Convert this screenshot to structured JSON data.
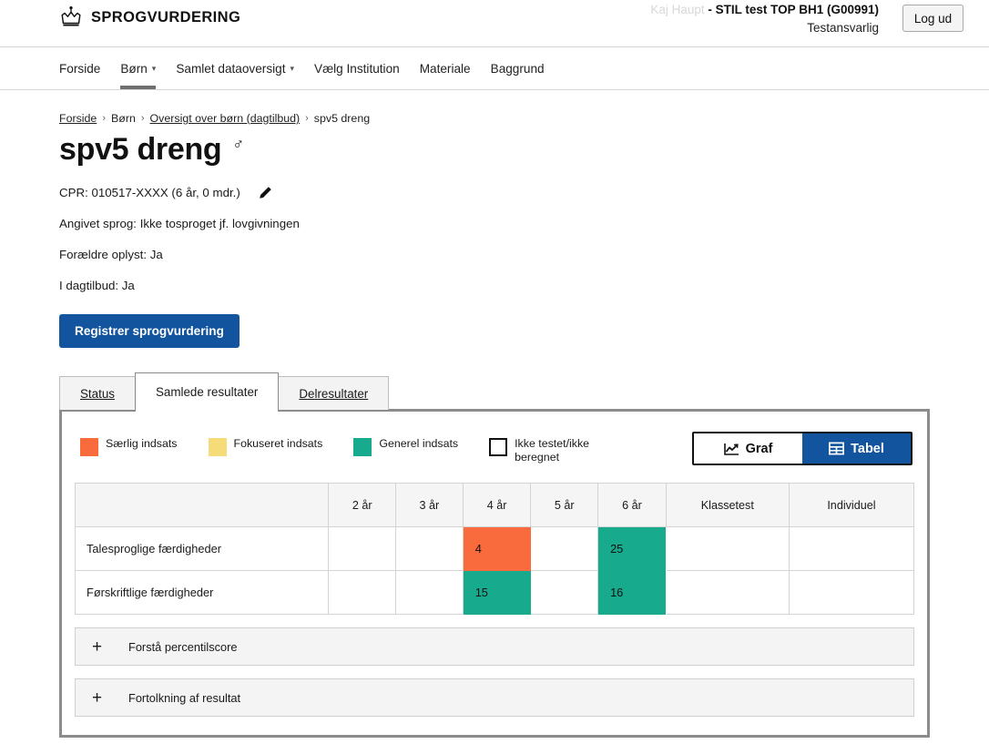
{
  "header": {
    "brand": "SPROGVURDERING",
    "brand_icon": "crown-icon",
    "user_name": "Kaj Haupt",
    "user_org": " - STIL test TOP BH1 (G00991)",
    "user_role": "Testansvarlig",
    "logout_label": "Log ud"
  },
  "nav": {
    "items": [
      {
        "label": "Forside",
        "caret": "",
        "active": false
      },
      {
        "label": "Børn",
        "caret": "⌄",
        "active": true
      },
      {
        "label": "Samlet dataoversigt",
        "caret": "⌄",
        "active": false
      },
      {
        "label": "Vælg Institution",
        "caret": "",
        "active": false
      },
      {
        "label": "Materiale",
        "caret": "",
        "active": false
      },
      {
        "label": "Baggrund",
        "caret": "",
        "active": false
      }
    ]
  },
  "breadcrumb": {
    "sep": "›",
    "items": [
      {
        "label": "Forside",
        "link": true
      },
      {
        "label": "Børn",
        "link": false
      },
      {
        "label": "Oversigt over børn (dagtilbud)",
        "link": true
      },
      {
        "label": "spv5 dreng",
        "link": false
      }
    ]
  },
  "child": {
    "title": "spv5 dreng",
    "gender_symbol": "♂",
    "cpr": "CPR: 010517-XXXX (6 år, 0 mdr.)",
    "edit_icon": "pencil-icon",
    "language": "Angivet sprog: Ikke tosproget jf. lovgivningen",
    "parents": "Forældre oplyst: Ja",
    "daycare": "I dagtilbud: Ja",
    "register_button": "Registrer sprogvurdering"
  },
  "tabs": [
    {
      "label": "Status",
      "active": false
    },
    {
      "label": "Samlede resultater",
      "active": true
    },
    {
      "label": "Delresultater",
      "active": false
    }
  ],
  "legend": [
    {
      "label": "Særlig indsats",
      "color": "#F96A3C",
      "outline": false
    },
    {
      "label": "Fokuseret indsats",
      "color": "#F5DC78",
      "outline": false
    },
    {
      "label": "Generel indsats",
      "color": "#17AA8C",
      "outline": false
    },
    {
      "label": "Ikke testet/ikke beregnet",
      "color": "#FFFFFF",
      "outline": true
    }
  ],
  "view_toggle": {
    "graf_label": "Graf",
    "graf_icon": "line-chart-icon",
    "tabel_label": "Tabel",
    "tabel_icon": "table-grid-icon",
    "active": "Tabel",
    "active_color": "#12549E"
  },
  "results_table": {
    "columns": [
      "",
      "2 år",
      "3 år",
      "4 år",
      "5 år",
      "6 år",
      "Klassetest",
      "Individuel"
    ],
    "rows": [
      {
        "label": "Talesproglige færdigheder",
        "cells": [
          {
            "value": "",
            "color": ""
          },
          {
            "value": "",
            "color": ""
          },
          {
            "value": "4",
            "color": "#F96A3C"
          },
          {
            "value": "",
            "color": ""
          },
          {
            "value": "25",
            "color": "#17AA8C"
          },
          {
            "value": "",
            "color": ""
          },
          {
            "value": "",
            "color": ""
          }
        ]
      },
      {
        "label": "Førskriftlige færdigheder",
        "cells": [
          {
            "value": "",
            "color": ""
          },
          {
            "value": "",
            "color": ""
          },
          {
            "value": "15",
            "color": "#17AA8C"
          },
          {
            "value": "",
            "color": ""
          },
          {
            "value": "16",
            "color": "#17AA8C"
          },
          {
            "value": "",
            "color": ""
          },
          {
            "value": "",
            "color": ""
          }
        ]
      }
    ]
  },
  "accordions": [
    {
      "plus": "+",
      "label": "Forstå percentilscore"
    },
    {
      "plus": "+",
      "label": "Fortolkning af resultat"
    }
  ]
}
